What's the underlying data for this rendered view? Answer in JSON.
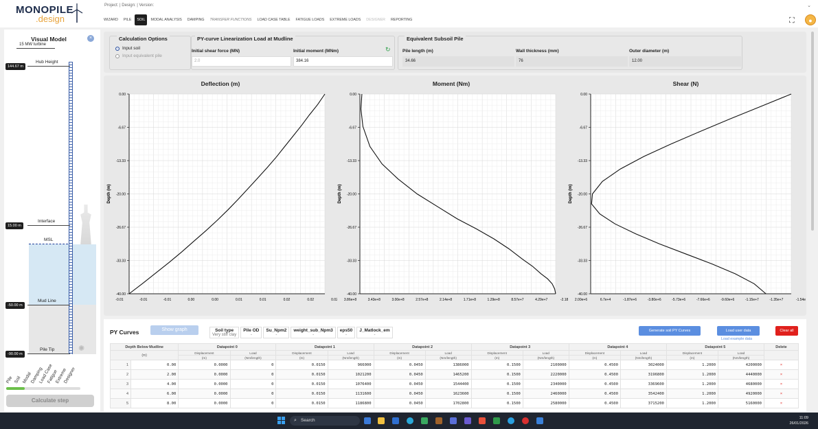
{
  "app": {
    "logo_line1": "MONOPILE",
    "logo_line2": ".design",
    "project_line": "Project: | Design: | Version:"
  },
  "tabs": [
    {
      "label": "WIZARD",
      "state": "normal"
    },
    {
      "label": "PILE",
      "state": "normal"
    },
    {
      "label": "SOIL",
      "state": "active"
    },
    {
      "label": "MODAL ANALYSIS",
      "state": "normal"
    },
    {
      "label": "DAMPING",
      "state": "normal"
    },
    {
      "label": "TRANSFER FUNCTIONS",
      "state": "italic"
    },
    {
      "label": "LOAD CASE TABLE",
      "state": "normal"
    },
    {
      "label": "FATIGUE LOADS",
      "state": "normal"
    },
    {
      "label": "EXTREME LOADS",
      "state": "normal"
    },
    {
      "label": "DESIGNER",
      "state": "disabled"
    },
    {
      "label": "REPORTING",
      "state": "normal"
    }
  ],
  "visual_model": {
    "title": "Visual Model",
    "turbine": "15 MW turbine",
    "hub_label": "Hub Height",
    "hub_elev": "144.67 m",
    "interface_label": "Interface",
    "interface_elev": "15.00 m",
    "msl_label": "MSL",
    "mudline_label": "Mud Line",
    "mudline_elev": "-50.00 m",
    "piletip_label": "Pile Tip",
    "piletip_elev": "-90.00 m",
    "steps": [
      "Pile",
      "Soil",
      "Modal",
      "Damping",
      "Load Case",
      "Fatigue",
      "Extreme",
      "Designer"
    ],
    "progress": 0.25,
    "calc_button": "Calculate step"
  },
  "calc_options": {
    "title": "Calculation Options",
    "opt1": "Input soil",
    "opt2": "Input equivalent pile",
    "selected": "Input soil"
  },
  "py_lin": {
    "title": "PY-curve Linearization Load at Mudline",
    "shear_label": "Initial shear force (MN)",
    "shear_value": "2.0",
    "moment_label": "Initial moment (MNm)",
    "moment_value": "384.16"
  },
  "eq_pile": {
    "title": "Equivalent Subsoil Pile",
    "len_label": "Pile length (m)",
    "len_value": "34.66",
    "wt_label": "Wall thickness (mm)",
    "wt_value": "76",
    "od_label": "Outer diameter (m)",
    "od_value": "12.00"
  },
  "chart_data": [
    {
      "type": "line",
      "title": "Deflection (m)",
      "ylabel": "Depth (m)",
      "yticks": [
        "0.00",
        "-6.67",
        "-13.33",
        "-20.00",
        "-26.67",
        "-33.33",
        "-40.00"
      ],
      "xticks": [
        "-0.01",
        "-0.01",
        "-0.01",
        "0.00",
        "0.00",
        "0.01",
        "0.01",
        "0.02",
        "0.02",
        "0.02"
      ],
      "ylim": [
        -40,
        0
      ],
      "grid": true,
      "x": [
        -0.0095,
        -0.0072,
        -0.005,
        -0.0028,
        -0.0007,
        0.0013,
        0.0033,
        0.0052,
        0.007,
        0.0087,
        0.0104,
        0.012,
        0.0136,
        0.0151,
        0.0165,
        0.0179,
        0.0193,
        0.0206,
        0.022,
        0.0232
      ],
      "y": [
        -40,
        -37.9,
        -35.8,
        -33.7,
        -31.6,
        -29.5,
        -27.4,
        -25.3,
        -23.2,
        -21.1,
        -18.9,
        -16.8,
        -14.7,
        -12.6,
        -10.5,
        -8.4,
        -6.3,
        -4.2,
        -2.1,
        0
      ]
    },
    {
      "type": "line",
      "title": "Moment (Nm)",
      "ylabel": "Depth (m)",
      "yticks": [
        "0.00",
        "-6.67",
        "-13.33",
        "-20.00",
        "-26.67",
        "-33.33",
        "-40.00"
      ],
      "xticks": [
        "3.86e+8",
        "3.43e+8",
        "3.00e+8",
        "2.57e+8",
        "2.14e+8",
        "1.71e+8",
        "1.29e+8",
        "8.57e+7",
        "4.29e+7",
        "-2.18e"
      ],
      "ylim": [
        -40,
        0
      ],
      "grid": true,
      "x": [
        0,
        2000000.0,
        7000000.0,
        16000000.0,
        29000000.0,
        46000000.0,
        67000000.0,
        93000000.0,
        123000000.0,
        158000000.0,
        196000000.0,
        236000000.0,
        276000000.0,
        314000000.0,
        346000000.0,
        370000000.0,
        384000000.0,
        388000000.0,
        386000000.0
      ],
      "y": [
        -40,
        -39,
        -38,
        -37,
        -36,
        -34.5,
        -33,
        -31,
        -29,
        -27,
        -25,
        -22.5,
        -20,
        -17,
        -14,
        -10.5,
        -6.5,
        -3,
        0
      ]
    },
    {
      "type": "line",
      "title": "Shear (N)",
      "ylabel": "Depth (m)",
      "yticks": [
        "0.00",
        "-6.67",
        "-13.33",
        "-20.00",
        "-26.67",
        "-33.33",
        "-40.00"
      ],
      "xticks": [
        "2.00e+6",
        "6.7e+4",
        "-1.87e+6",
        "-3.80e+6",
        "-5.73e+6",
        "-7.66e+6",
        "-9.60e+6",
        "-1.15e+7",
        "-1.35e+7",
        "-1.54e"
      ],
      "ylim": [
        -40,
        0
      ],
      "grid": true,
      "x": [
        2000000.0,
        -1400000.0,
        -4800000.0,
        -8100000.0,
        -11300000.0,
        -14300000.0,
        -16900000.0,
        -18900000.0,
        -20000000.0,
        -20100000.0,
        -19200000.0,
        -17500000.0,
        -15200000.0,
        -12600000.0,
        -9700000.0,
        -6800000.0,
        -4200000.0,
        -2100000.0,
        -800000.0
      ],
      "y": [
        0,
        -2.5,
        -5,
        -7.5,
        -10,
        -12.5,
        -15,
        -17.5,
        -20,
        -22,
        -24,
        -26,
        -28,
        -30,
        -32,
        -34,
        -36,
        -38,
        -40
      ]
    }
  ],
  "py_curves": {
    "title": "PY Curves",
    "show_graph": "Show graph",
    "params": [
      {
        "h": "Soil type",
        "v": "Very stiff clay"
      },
      {
        "h": "Pile OD",
        "v": "-"
      },
      {
        "h": "Su_Npm2",
        "v": "-"
      },
      {
        "h": "weight_sub_Npm3",
        "v": "-"
      },
      {
        "h": "eps50",
        "v": "-"
      },
      {
        "h": "J_Matlock_em",
        "v": "-"
      }
    ],
    "gen_btn": "Generate soil PY Curves",
    "load_btn": "Load user data",
    "load_example": "Load example data",
    "clear_btn": "Clear all",
    "depth_header": "Depth Below Mudline",
    "depth_unit": "(m)",
    "dp_headers": [
      "Datapoint 0",
      "Datapoint 1",
      "Datapoint 2",
      "Datapoint 3",
      "Datapoint 4",
      "Datapoint 5"
    ],
    "disp_label": "Displacement",
    "load_label": "Load",
    "disp_unit": "(m)",
    "load_unit": "(Nm/length)",
    "delete_header": "Delete",
    "rows": [
      {
        "i": "1",
        "d": "0.00",
        "v": [
          "0.0000",
          "0",
          "0.0150",
          "966000",
          "0.0450",
          "1386000",
          "0.1500",
          "2100000",
          "0.4500",
          "3024000",
          "1.2000",
          "4200000"
        ]
      },
      {
        "i": "2",
        "d": "2.00",
        "v": [
          "0.0000",
          "0",
          "0.0150",
          "1021200",
          "0.0450",
          "1465200",
          "0.1500",
          "2220000",
          "0.4500",
          "3196800",
          "1.2000",
          "4440000"
        ]
      },
      {
        "i": "3",
        "d": "4.00",
        "v": [
          "0.0000",
          "0",
          "0.0150",
          "1076400",
          "0.0450",
          "1544400",
          "0.1500",
          "2340000",
          "0.4500",
          "3369600",
          "1.2000",
          "4680000"
        ]
      },
      {
        "i": "4",
        "d": "6.00",
        "v": [
          "0.0000",
          "0",
          "0.0150",
          "1131600",
          "0.0450",
          "1623600",
          "0.1500",
          "2460000",
          "0.4500",
          "3542400",
          "1.2000",
          "4920000"
        ]
      },
      {
        "i": "5",
        "d": "8.00",
        "v": [
          "0.0000",
          "0",
          "0.0150",
          "1186800",
          "0.0450",
          "1702800",
          "0.1500",
          "2580000",
          "0.4500",
          "3715200",
          "1.2000",
          "5160000"
        ]
      }
    ],
    "delete_symbol": "×"
  },
  "taskbar": {
    "search": "Search",
    "time": "11:09",
    "date": "26/01/2026"
  }
}
